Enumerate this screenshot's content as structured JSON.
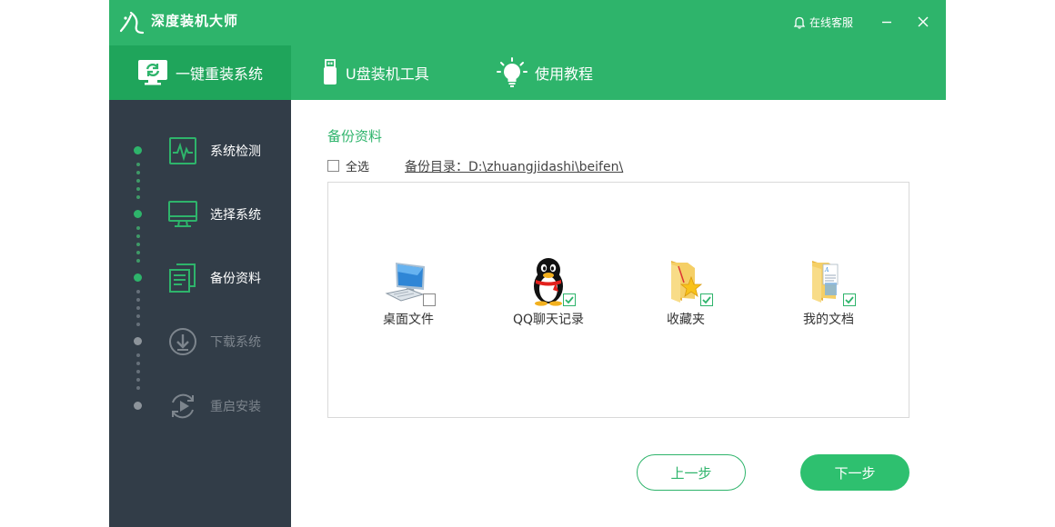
{
  "app": {
    "title": "深度装机大师",
    "support": "在线客服"
  },
  "tabs": [
    {
      "label": "一键重装系统",
      "icon": "monitor-refresh-icon",
      "active": true
    },
    {
      "label": "U盘装机工具",
      "icon": "usb-drive-icon",
      "active": false
    },
    {
      "label": "使用教程",
      "icon": "lightbulb-icon",
      "active": false
    }
  ],
  "steps": [
    {
      "label": "系统检测",
      "icon": "pulse-monitor-icon",
      "done": true
    },
    {
      "label": "选择系统",
      "icon": "monitor-icon",
      "done": true
    },
    {
      "label": "备份资料",
      "icon": "documents-icon",
      "done": true
    },
    {
      "label": "下载系统",
      "icon": "download-icon",
      "done": false
    },
    {
      "label": "重启安装",
      "icon": "restart-icon",
      "done": false
    }
  ],
  "backup": {
    "title": "备份资料",
    "select_all": "全选",
    "select_all_checked": false,
    "directory": "备份目录：D:\\zhuangjidashi\\beifen\\",
    "items": [
      {
        "label": "桌面文件",
        "icon": "desktop-computer-icon",
        "checked": false
      },
      {
        "label": "QQ聊天记录",
        "icon": "qq-penguin-icon",
        "checked": true
      },
      {
        "label": "收藏夹",
        "icon": "favorites-folder-icon",
        "checked": true
      },
      {
        "label": "我的文档",
        "icon": "documents-folder-icon",
        "checked": true
      }
    ]
  },
  "buttons": {
    "prev": "上一步",
    "next": "下一步"
  },
  "colors": {
    "brand": "#2eb46b",
    "brand_dark": "#1fa55b",
    "sidebar": "#323d48"
  }
}
